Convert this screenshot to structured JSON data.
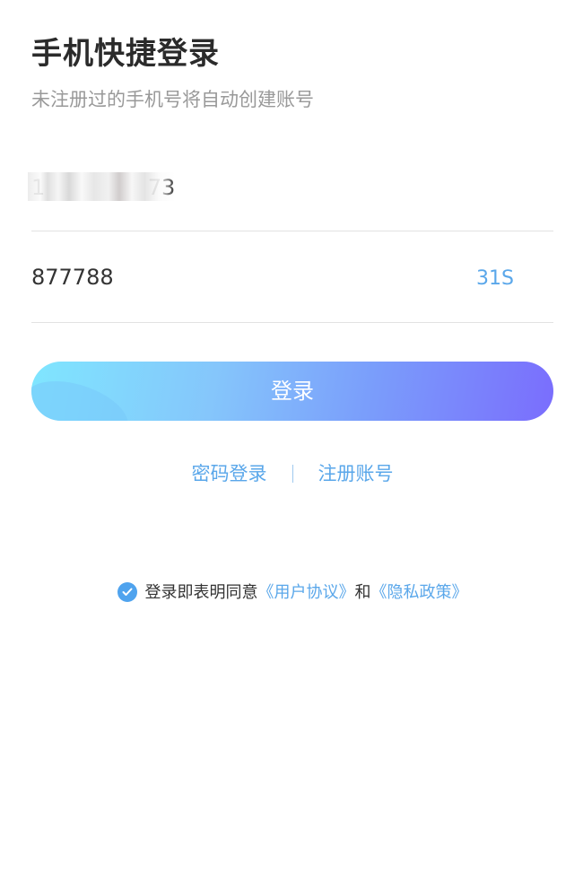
{
  "header": {
    "title": "手机快捷登录",
    "subtitle": "未注册过的手机号将自动创建账号"
  },
  "form": {
    "phone": {
      "value": "1               73",
      "masked": true
    },
    "code": {
      "value": "877788",
      "countdown": "31S"
    },
    "login_label": "登录"
  },
  "links": {
    "password_login": "密码登录",
    "register": "注册账号"
  },
  "agreement": {
    "checked": true,
    "prefix": "登录即表明同意",
    "user_agreement": "《用户协议》",
    "conjunction": "和",
    "privacy_policy": "《隐私政策》"
  },
  "colors": {
    "accent": "#5aa7ea",
    "checkbox": "#4fa3ee",
    "button_gradient_start": "#7fe6ff",
    "button_gradient_end": "#7a6dfd",
    "title": "#2b2b2b",
    "subtitle": "#999999",
    "divider": "#e2e2e2"
  },
  "icons": {
    "agreement_check": "check-circle-icon"
  }
}
